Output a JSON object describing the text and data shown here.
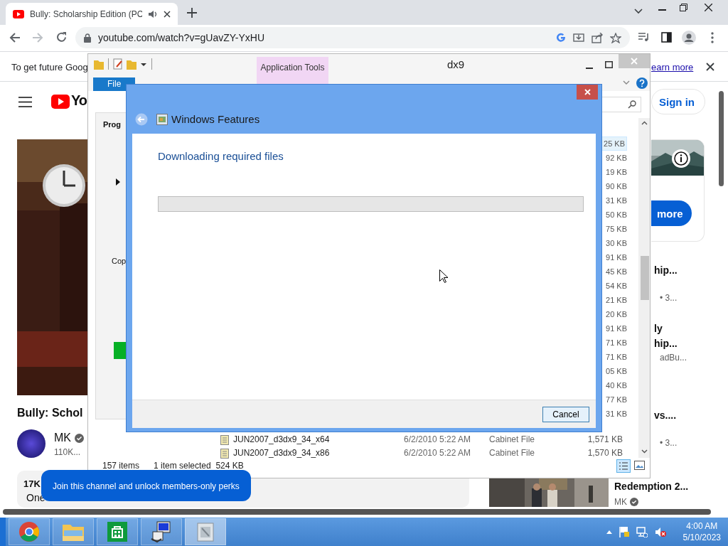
{
  "browser": {
    "tab": {
      "title": "Bully: Scholarship Edition (PC",
      "audio": true
    },
    "address": "youtube.com/watch?v=gUavZY-YxHU",
    "infobar": {
      "text": "To get future Goog",
      "link": "earn more"
    }
  },
  "youtube": {
    "logo_text": "Yo",
    "sign_in": "Sign in",
    "ad_button": "more",
    "video_title": "Bully: Schol",
    "channel": "MK",
    "subscribers": "110K...",
    "likes": "17K",
    "description": "One",
    "join_banner": "Join this channel and unlock members-only perks",
    "recommendations": [
      {
        "lines": [
          "hip..."
        ],
        "meta": "• 3..."
      },
      {
        "lines": [
          "ly",
          "hip..."
        ],
        "meta": "adBu..."
      },
      {
        "lines": [
          "vs...."
        ],
        "meta": "• 3..."
      }
    ],
    "bottom_video": {
      "title": "Redemption 2...",
      "channel": "MK"
    }
  },
  "explorer": {
    "title": "dx9",
    "context_tab": "Application Tools",
    "ribbon_tabs": [
      {
        "label": "File",
        "selected": true
      }
    ],
    "behind_texts": [
      "Prog",
      "Cop"
    ],
    "sizes": [
      {
        "text": "25 KB",
        "selected": true
      },
      {
        "text": "92 KB",
        "selected": false
      },
      {
        "text": "19 KB",
        "selected": false
      },
      {
        "text": "90 KB",
        "selected": false
      },
      {
        "text": "31 KB",
        "selected": false
      },
      {
        "text": "50 KB",
        "selected": false
      },
      {
        "text": "75 KB",
        "selected": false
      },
      {
        "text": "30 KB",
        "selected": false
      },
      {
        "text": "91 KB",
        "selected": false
      },
      {
        "text": "45 KB",
        "selected": false
      },
      {
        "text": "54 KB",
        "selected": false
      },
      {
        "text": "21 KB",
        "selected": false
      },
      {
        "text": "20 KB",
        "selected": false
      },
      {
        "text": "91 KB",
        "selected": false
      },
      {
        "text": "71 KB",
        "selected": false
      },
      {
        "text": "71 KB",
        "selected": false
      },
      {
        "text": "05 KB",
        "selected": false
      },
      {
        "text": "40 KB",
        "selected": false
      },
      {
        "text": "77 KB",
        "selected": false
      },
      {
        "text": "31 KB",
        "selected": false
      }
    ],
    "rows": [
      {
        "name": "JUN2007_d3dx9_34_x64",
        "date": "6/2/2010 5:22 AM",
        "type": "Cabinet File",
        "size": "1,571 KB"
      },
      {
        "name": "JUN2007_d3dx9_34_x86",
        "date": "6/2/2010 5:22 AM",
        "type": "Cabinet File",
        "size": "1,570 KB"
      }
    ],
    "status": {
      "count": "157 items",
      "selection": "1 item selected  524 KB"
    }
  },
  "dialog": {
    "title": "Windows Features",
    "heading": "Downloading required files",
    "level": 0,
    "cancel": "Cancel"
  },
  "taskbar": {
    "apps": [
      {
        "kind": "browser",
        "selected": false
      },
      {
        "kind": "folder",
        "selected": false
      },
      {
        "kind": "store",
        "selected": false
      },
      {
        "kind": "setup",
        "selected": false
      },
      {
        "kind": "package",
        "selected": true
      }
    ],
    "time": "4:00 AM",
    "date": "5/10/2023"
  }
}
